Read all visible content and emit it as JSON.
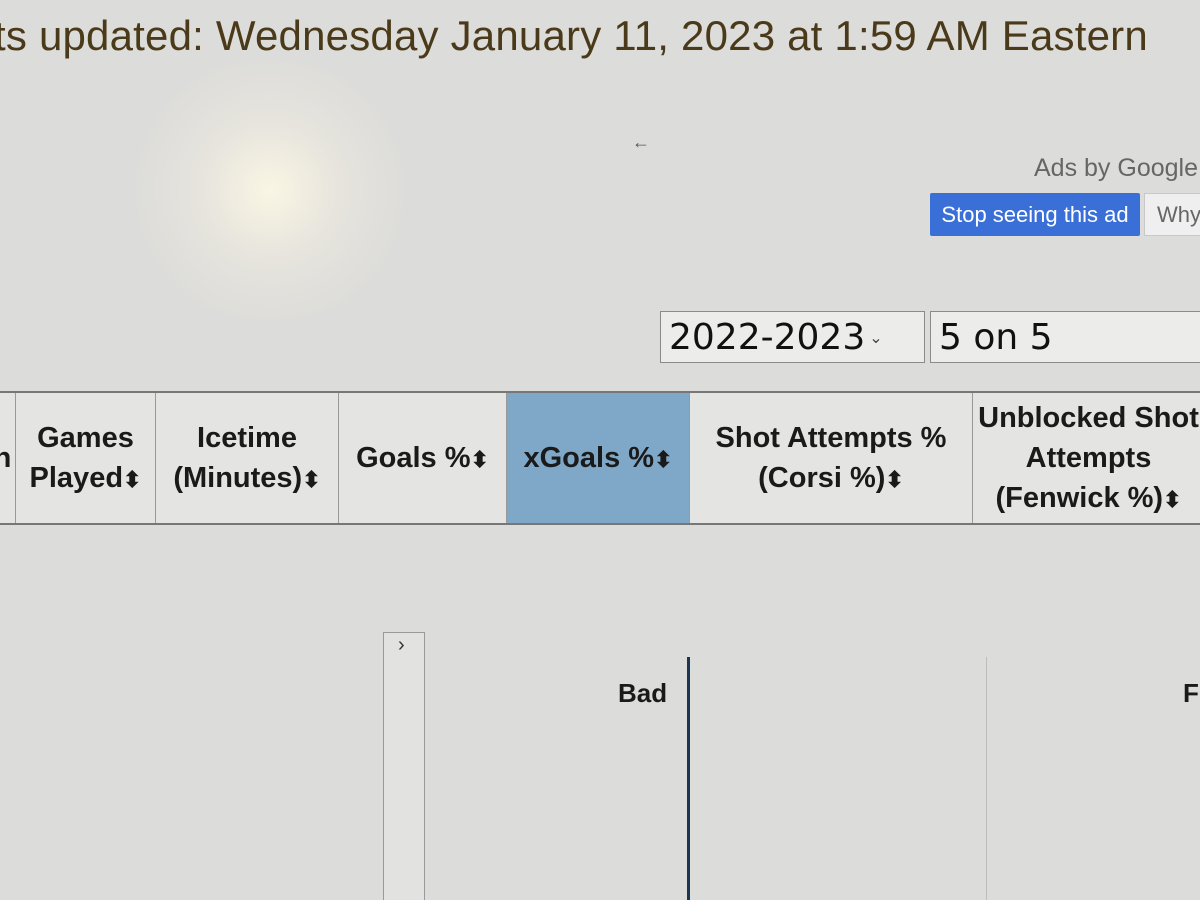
{
  "header": {
    "updated_text": "ts updated: Wednesday January 11, 2023 at 1:59 AM Eastern"
  },
  "nav": {
    "back_arrow": "←"
  },
  "ad": {
    "ads_by": "Ads by Google",
    "stop_button": "Stop seeing this ad",
    "why_button": "Why"
  },
  "filters": {
    "season": "2022-2023",
    "strength": "5 on 5"
  },
  "table": {
    "sort_icon": "⬍",
    "columns": [
      {
        "label": "n"
      },
      {
        "label": "Games Played"
      },
      {
        "label": "Icetime (Minutes)"
      },
      {
        "label": "Goals %"
      },
      {
        "label": "xGoals %",
        "active": true
      },
      {
        "label": "Shot Attempts % (Corsi %)"
      },
      {
        "label": "Unblocked Shot Attempts (Fenwick %)"
      }
    ]
  },
  "chart": {
    "expand_icon": "›",
    "bad_label": "Bad",
    "right_label": "F"
  },
  "colors": {
    "active_header": "#7fa8c8",
    "ad_button": "#3b6fd8"
  }
}
